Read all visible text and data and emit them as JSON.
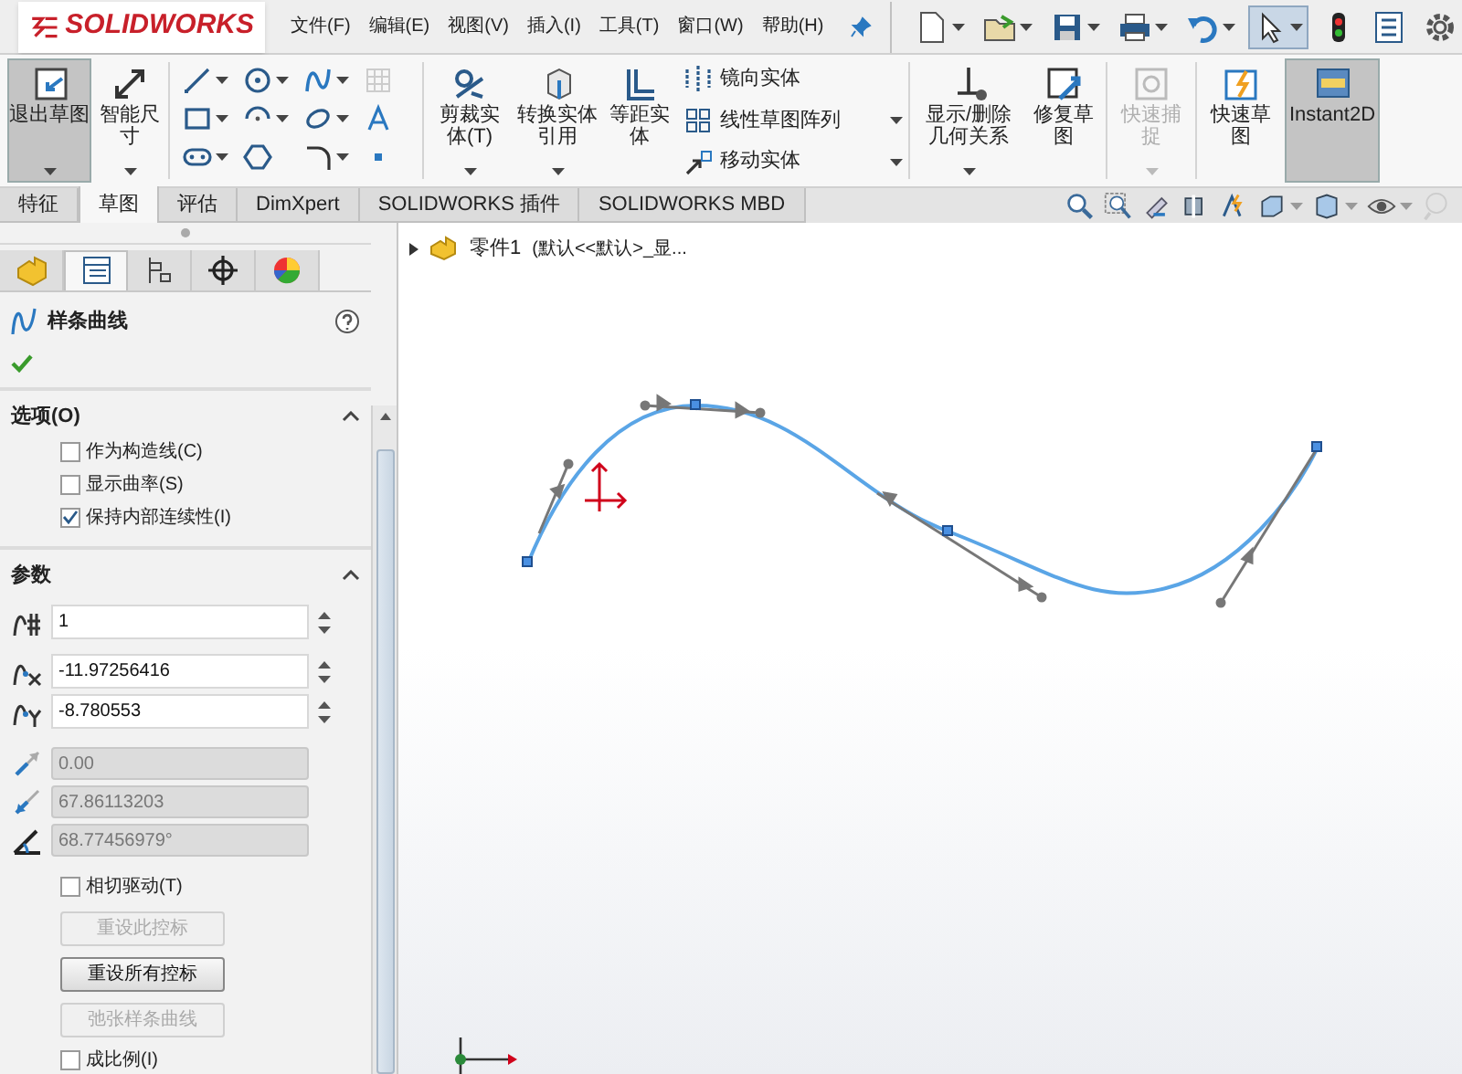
{
  "app": {
    "logo": "SOLIDWORKS"
  },
  "menu": [
    "文件(F)",
    "编辑(E)",
    "视图(V)",
    "插入(I)",
    "工具(T)",
    "窗口(W)",
    "帮助(H)"
  ],
  "quick_access": [
    {
      "kind": "new",
      "selected": false
    },
    {
      "kind": "open",
      "selected": false
    },
    {
      "kind": "save",
      "selected": false
    },
    {
      "kind": "print",
      "selected": false
    },
    {
      "kind": "undo",
      "selected": false
    },
    {
      "kind": "select",
      "selected": true
    },
    {
      "kind": "rebuild",
      "selected": false
    },
    {
      "kind": "file-properties",
      "selected": false
    },
    {
      "kind": "options",
      "selected": false
    }
  ],
  "ribbon": [
    {
      "kind": "large",
      "label": "退出草图",
      "pressed": true,
      "disabled": false,
      "caret": true
    },
    {
      "kind": "large",
      "label": "智能尺寸",
      "pressed": false,
      "disabled": false,
      "caret": true
    },
    {
      "kind": "large",
      "label": "剪裁实体(T)",
      "pressed": false,
      "disabled": false,
      "caret": true
    },
    {
      "kind": "large",
      "label": "转换实体引用",
      "pressed": false,
      "disabled": false,
      "caret": true
    },
    {
      "kind": "large",
      "label": "等距实体",
      "pressed": false,
      "disabled": false,
      "caret": false
    },
    {
      "kind": "stack",
      "items": [
        {
          "label": "镜向实体",
          "caret": false
        },
        {
          "label": "线性草图阵列",
          "caret": true
        },
        {
          "label": "移动实体",
          "caret": true
        }
      ]
    },
    {
      "kind": "large",
      "label": "显示/删除几何关系",
      "pressed": false,
      "disabled": false,
      "caret": true
    },
    {
      "kind": "large",
      "label": "修复草图",
      "pressed": false,
      "disabled": false,
      "caret": false
    },
    {
      "kind": "large",
      "label": "快速捕捉",
      "pressed": false,
      "disabled": true,
      "caret": true
    },
    {
      "kind": "large",
      "label": "快速草图",
      "pressed": false,
      "disabled": false,
      "caret": false
    },
    {
      "kind": "large",
      "label": "Instant2D",
      "pressed": true,
      "disabled": false,
      "caret": false
    }
  ],
  "tabs": [
    {
      "label": "特征",
      "selected": false
    },
    {
      "label": "草图",
      "selected": true
    },
    {
      "label": "评估",
      "selected": false
    },
    {
      "label": "DimXpert",
      "selected": false
    },
    {
      "label": "SOLIDWORKS 插件",
      "selected": false
    },
    {
      "label": "SOLIDWORKS MBD",
      "selected": false
    }
  ],
  "panel_tabs": [
    {
      "kind": "feature-tree",
      "selected": false
    },
    {
      "kind": "property-manager",
      "selected": true
    },
    {
      "kind": "configuration",
      "selected": false
    },
    {
      "kind": "dimxpert",
      "selected": false
    },
    {
      "kind": "display",
      "selected": false
    }
  ],
  "property_manager": {
    "title": "样条曲线",
    "options": {
      "title": "选项(O)",
      "expanded": true,
      "checkboxes": [
        {
          "label": "作为构造线(C)",
          "checked": false
        },
        {
          "label": "显示曲率(S)",
          "checked": false
        },
        {
          "label": "保持内部连续性(I)",
          "checked": true
        }
      ]
    },
    "parameters": {
      "title": "参数",
      "expanded": true,
      "fields": [
        {
          "value": "1",
          "disabled": false
        },
        {
          "value": "-11.97256416",
          "disabled": false
        },
        {
          "value": "-8.780553",
          "disabled": false
        },
        {
          "value": "0.00",
          "disabled": true
        },
        {
          "value": "67.86113203",
          "disabled": true
        },
        {
          "value": "68.77456979°",
          "disabled": true
        }
      ],
      "tangent_driving": {
        "label": "相切驱动(T)",
        "checked": false
      },
      "buttons": [
        {
          "label": "重设此控标",
          "disabled": true
        },
        {
          "label": "重设所有控标",
          "disabled": false
        },
        {
          "label": "弛张样条曲线",
          "disabled": true
        }
      ],
      "proportional": {
        "label": "成比例(I)",
        "checked": false
      }
    }
  },
  "tree": {
    "label": "零件1",
    "detail": "(默认<<默认>_显..."
  }
}
